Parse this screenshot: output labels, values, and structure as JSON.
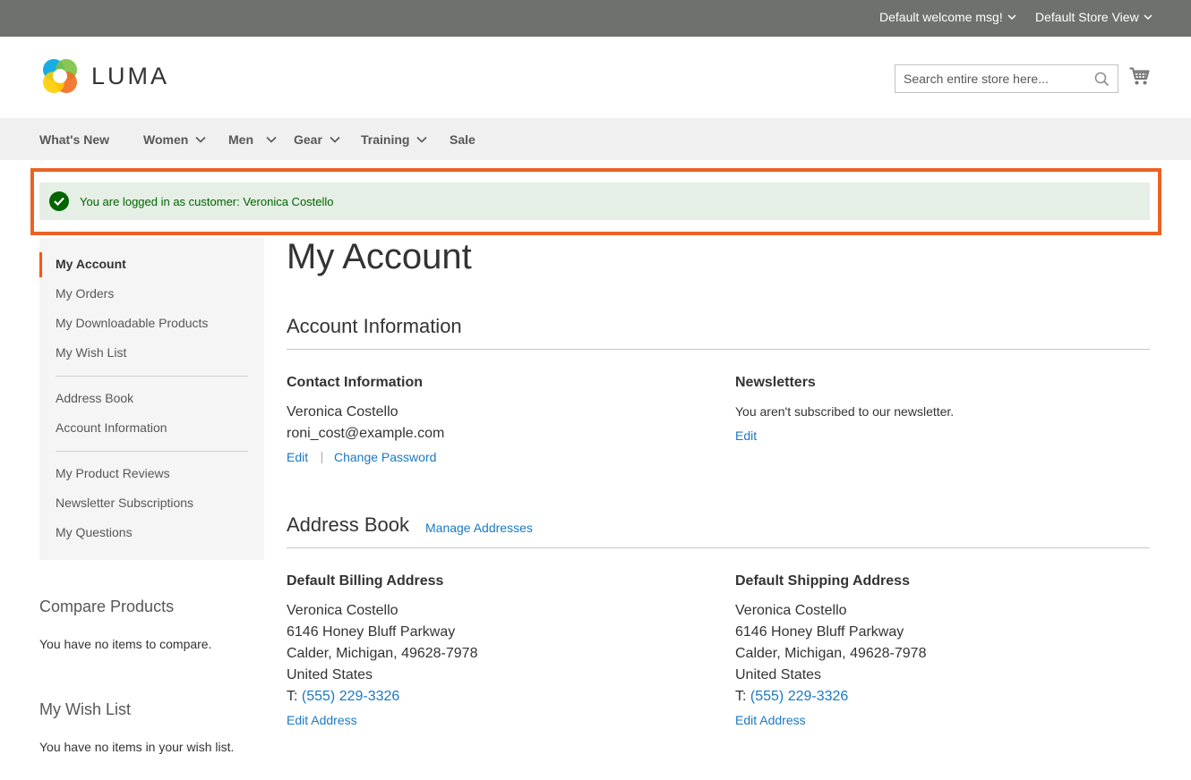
{
  "topbar": {
    "welcome": "Default welcome msg!",
    "store_view": "Default Store View"
  },
  "header": {
    "logo_text": "LUMA",
    "search_placeholder": "Search entire store here..."
  },
  "nav": {
    "items": [
      {
        "label": "What's New",
        "dropdown": false
      },
      {
        "label": "Women",
        "dropdown": true
      },
      {
        "label": "Men",
        "dropdown": true
      },
      {
        "label": "Gear",
        "dropdown": true
      },
      {
        "label": "Training",
        "dropdown": true
      },
      {
        "label": "Sale",
        "dropdown": false
      }
    ]
  },
  "message": {
    "text": "You are logged in as customer: Veronica Costello"
  },
  "sidebar": {
    "items": [
      "My Account",
      "My Orders",
      "My Downloadable Products",
      "My Wish List",
      "Address Book",
      "Account Information",
      "My Product Reviews",
      "Newsletter Subscriptions",
      "My Questions"
    ],
    "active": "My Account"
  },
  "compare": {
    "title": "Compare Products",
    "text": "You have no items to compare."
  },
  "wishlist": {
    "title": "My Wish List",
    "text": "You have no items in your wish list."
  },
  "main": {
    "page_title": "My Account",
    "account_info": {
      "title": "Account Information",
      "contact": {
        "title": "Contact Information",
        "name": "Veronica Costello",
        "email": "roni_cost@example.com",
        "edit": "Edit",
        "change_password": "Change Password"
      },
      "newsletters": {
        "title": "Newsletters",
        "text": "You aren't subscribed to our newsletter.",
        "edit": "Edit"
      }
    },
    "address_book": {
      "title": "Address Book",
      "manage": "Manage Addresses",
      "billing": {
        "title": "Default Billing Address",
        "name": "Veronica Costello",
        "street": "6146 Honey Bluff Parkway",
        "city": "Calder, Michigan, 49628-7978",
        "country": "United States",
        "phone_prefix": "T:",
        "phone": "(555) 229-3326",
        "edit": "Edit Address"
      },
      "shipping": {
        "title": "Default Shipping Address",
        "name": "Veronica Costello",
        "street": "6146 Honey Bluff Parkway",
        "city": "Calder, Michigan, 49628-7978",
        "country": "United States",
        "phone_prefix": "T:",
        "phone": "(555) 229-3326",
        "edit": "Edit Address"
      }
    }
  },
  "colors": {
    "topbar_bg": "#6e716e",
    "nav_bg": "#f0f0f0",
    "link": "#1979c3",
    "success_bg": "#e5efe5",
    "success_text": "#006400",
    "highlight_border": "#ec6223",
    "active_marker": "#ff5501"
  }
}
